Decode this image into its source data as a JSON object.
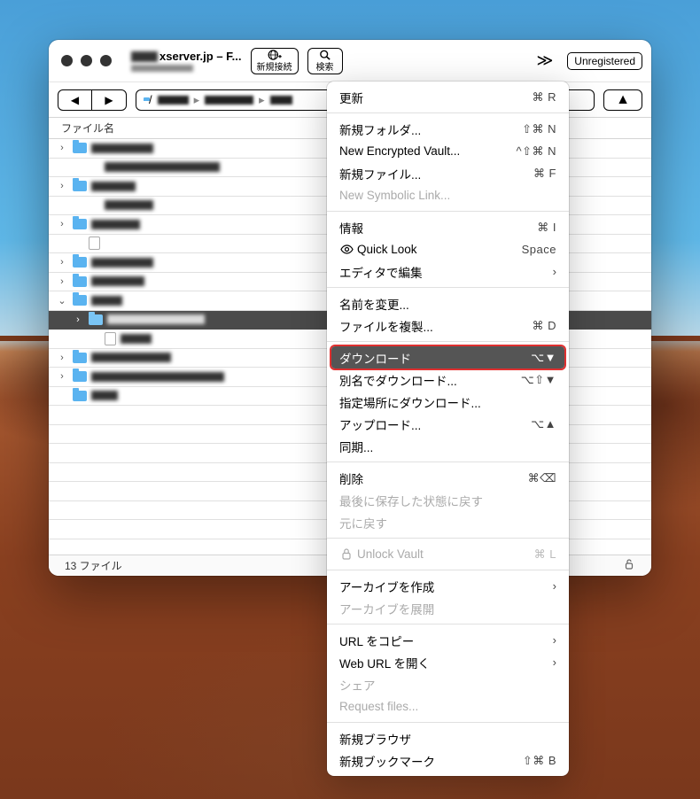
{
  "window": {
    "title_suffix": "xserver.jp – F...",
    "unregistered_label": "Unregistered",
    "toolbar": {
      "new_connection_label": "新規接続",
      "search_label": "検索",
      "more_glyph": "≫"
    },
    "path_prefix": "/",
    "column_header": "ファイル名",
    "status_count": "13 ファイル"
  },
  "rows": [
    {
      "kind": "folder",
      "disclosure": "›",
      "indent": 0,
      "name_w": 70,
      "blur": true
    },
    {
      "kind": "blank",
      "indent": 2,
      "name_w": 130,
      "blur": true
    },
    {
      "kind": "folder",
      "disclosure": "›",
      "indent": 0,
      "name_w": 50,
      "blur": true
    },
    {
      "kind": "blank",
      "indent": 2,
      "name_w": 55,
      "blur": true
    },
    {
      "kind": "folder",
      "disclosure": "›",
      "indent": 0,
      "name_w": 55,
      "blur": true
    },
    {
      "kind": "file",
      "indent": 1,
      "name_w": 0,
      "blur": false
    },
    {
      "kind": "folder",
      "disclosure": "›",
      "indent": 0,
      "name_w": 70,
      "blur": true
    },
    {
      "kind": "folder",
      "disclosure": "›",
      "indent": 0,
      "name_w": 60,
      "blur": true
    },
    {
      "kind": "folder",
      "disclosure": "⌄",
      "indent": 0,
      "name_w": 35,
      "blur": true
    },
    {
      "kind": "folder",
      "disclosure": "›",
      "indent": 1,
      "name_w": 110,
      "blur": true,
      "selected": true
    },
    {
      "kind": "file",
      "indent": 2,
      "name_w": 35,
      "blur": true
    },
    {
      "kind": "folder",
      "disclosure": "›",
      "indent": 0,
      "name_w": 90,
      "blur": true
    },
    {
      "kind": "folder",
      "disclosure": "›",
      "indent": 0,
      "name_w": 150,
      "blur": true
    },
    {
      "kind": "folder",
      "disclosure": "",
      "indent": 0,
      "name_w": 30,
      "blur": true
    }
  ],
  "menu": [
    {
      "type": "item",
      "label": "更新",
      "shortcut": "⌘ R"
    },
    {
      "type": "sep"
    },
    {
      "type": "item",
      "label": "新規フォルダ...",
      "shortcut": "⇧⌘ N"
    },
    {
      "type": "item",
      "label": "New Encrypted Vault...",
      "shortcut": "^⇧⌘ N"
    },
    {
      "type": "item",
      "label": "新規ファイル...",
      "shortcut": "⌘ F"
    },
    {
      "type": "item",
      "label": "New Symbolic Link...",
      "disabled": true
    },
    {
      "type": "sep"
    },
    {
      "type": "item",
      "label": "情報",
      "shortcut": "⌘ I"
    },
    {
      "type": "item",
      "label": "Quick Look",
      "shortcut": "Space",
      "icon": "eye"
    },
    {
      "type": "item",
      "label": "エディタで編集",
      "submenu": true
    },
    {
      "type": "sep"
    },
    {
      "type": "item",
      "label": "名前を変更..."
    },
    {
      "type": "item",
      "label": "ファイルを複製...",
      "shortcut": "⌘ D"
    },
    {
      "type": "sep"
    },
    {
      "type": "item",
      "label": "ダウンロード",
      "shortcut": "⌥▼",
      "highlighted": true
    },
    {
      "type": "item",
      "label": "別名でダウンロード...",
      "shortcut": "⌥⇧▼"
    },
    {
      "type": "item",
      "label": "指定場所にダウンロード..."
    },
    {
      "type": "item",
      "label": "アップロード...",
      "shortcut": "⌥▲"
    },
    {
      "type": "item",
      "label": "同期..."
    },
    {
      "type": "sep"
    },
    {
      "type": "item",
      "label": "削除",
      "shortcut": "⌘⌫"
    },
    {
      "type": "item",
      "label": "最後に保存した状態に戻す",
      "disabled": true
    },
    {
      "type": "item",
      "label": "元に戻す",
      "disabled": true
    },
    {
      "type": "sep"
    },
    {
      "type": "item",
      "label": "Unlock Vault",
      "shortcut": "⌘ L",
      "icon": "lock",
      "disabled": true
    },
    {
      "type": "sep"
    },
    {
      "type": "item",
      "label": "アーカイブを作成",
      "submenu": true
    },
    {
      "type": "item",
      "label": "アーカイブを展開",
      "disabled": true
    },
    {
      "type": "sep"
    },
    {
      "type": "item",
      "label": "URL をコピー",
      "submenu": true
    },
    {
      "type": "item",
      "label": "Web URL を開く",
      "submenu": true
    },
    {
      "type": "item",
      "label": "シェア",
      "disabled": true
    },
    {
      "type": "item",
      "label": "Request files...",
      "disabled": true
    },
    {
      "type": "sep"
    },
    {
      "type": "item",
      "label": "新規ブラウザ"
    },
    {
      "type": "item",
      "label": "新規ブックマーク",
      "shortcut": "⇧⌘ B"
    }
  ]
}
